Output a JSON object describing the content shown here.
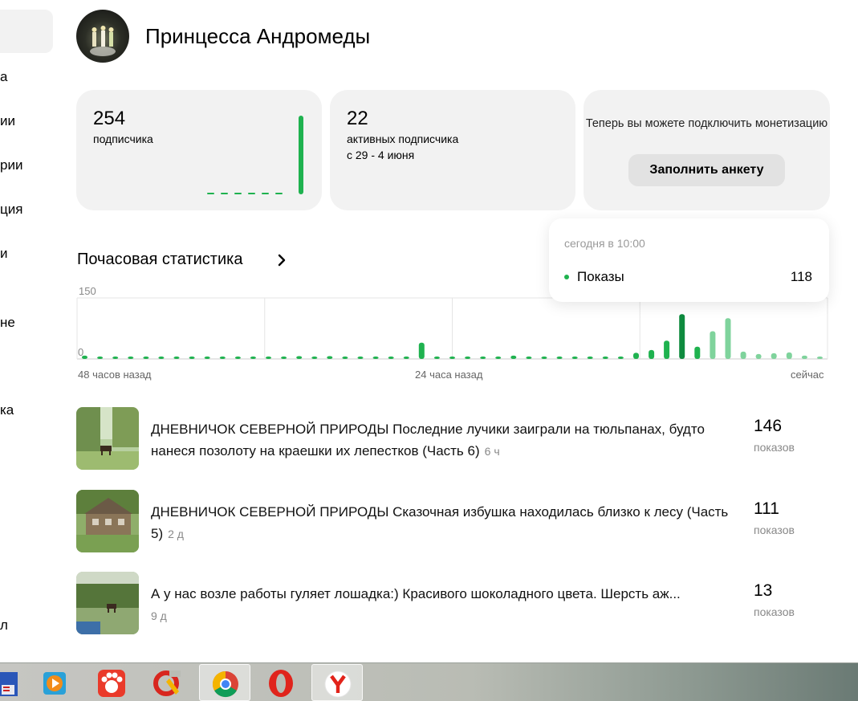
{
  "sidebar": {
    "items": [
      "а",
      "ии",
      "рии",
      "ция",
      "и",
      "не",
      "ка",
      "л"
    ]
  },
  "header": {
    "title": "Принцесса Андромеды"
  },
  "cards": {
    "subscribers": {
      "value": "254",
      "label": "подписчика"
    },
    "active": {
      "value": "22",
      "label": "активных подписчика",
      "period": "с 29 - 4 июня"
    },
    "monetization": {
      "text": "Теперь вы можете подключить монетизацию",
      "button": "Заполнить анкету"
    }
  },
  "hourly": {
    "title": "Почасовая статистика",
    "x_labels": {
      "left": "48 часов назад",
      "middle": "24 часа назад",
      "right": "сейчас"
    }
  },
  "tooltip": {
    "time": "сегодня в 10:00",
    "metric": "Показы",
    "value": "118"
  },
  "chart_data": {
    "type": "bar",
    "ylim": [
      0,
      150
    ],
    "ytick_labels": [
      "150",
      "0"
    ],
    "values": [
      8,
      5,
      5,
      5,
      5,
      5,
      5,
      5,
      5,
      5,
      5,
      5,
      5,
      6,
      7,
      6,
      7,
      6,
      6,
      6,
      6,
      6,
      40,
      6,
      5,
      5,
      5,
      6,
      8,
      6,
      5,
      5,
      5,
      5,
      5,
      6,
      15,
      22,
      45,
      110,
      30,
      68,
      100,
      18,
      12,
      14,
      16,
      8,
      5
    ],
    "highlight_index": 39
  },
  "posts": [
    {
      "title": "ДНЕВНИЧОК СЕВЕРНОЙ ПРИРОДЫ Последние лучики заиграли на тюльпанах, будто нанеся позолоту на краешки их лепестков (Часть 6)",
      "age": "6 ч",
      "views": "146",
      "unit": "показов"
    },
    {
      "title": "ДНЕВНИЧОК СЕВЕРНОЙ ПРИРОДЫ Сказочная избушка находилась близко к лесу (Часть 5)",
      "age": "2 д",
      "views": "111",
      "unit": "показов"
    },
    {
      "title": "А у нас возле работы гуляет лошадка:) Красивого шоколадного цвета. Шерсть аж...",
      "age": "9 д",
      "views": "13",
      "unit": "показов"
    }
  ],
  "colors": {
    "green": "#1fb24f",
    "dark_green": "#0e8a3e",
    "light_green": "#7fd39c",
    "card_bg": "#f2f2f2"
  }
}
